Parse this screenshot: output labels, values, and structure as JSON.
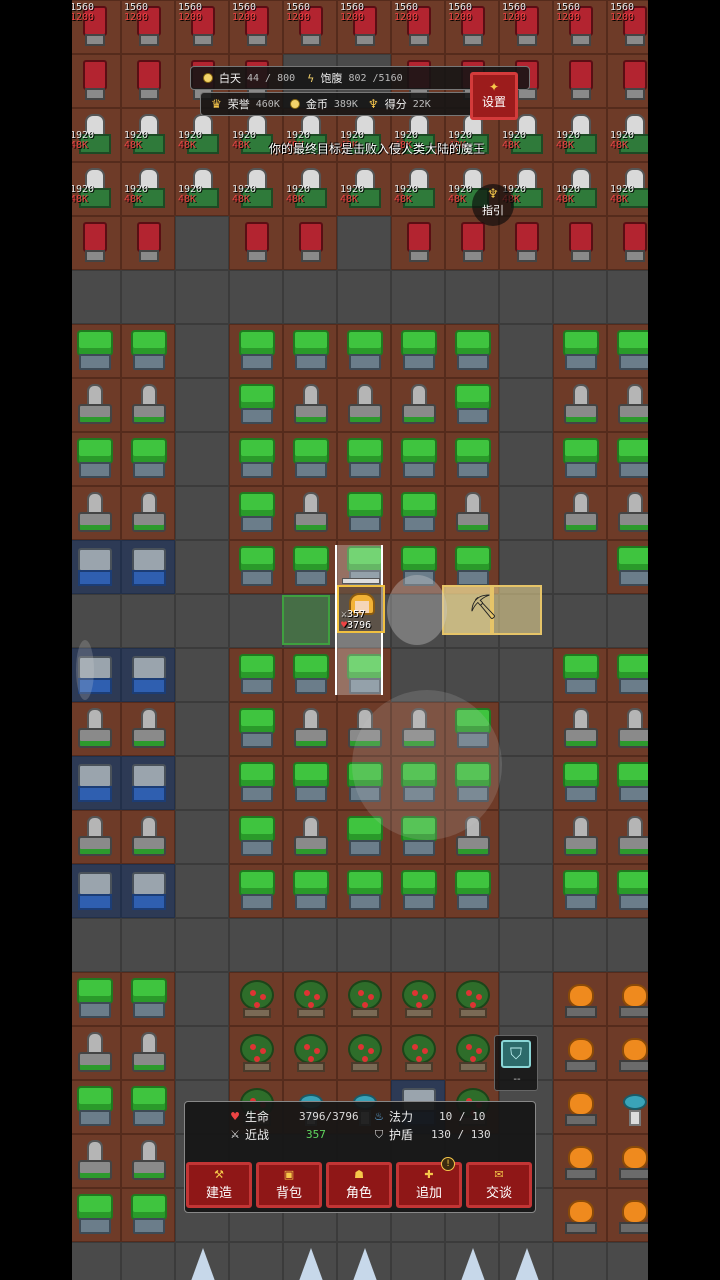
{
  "hud": {
    "day_label": "白天",
    "day_value": "44 / 800",
    "food_label": "饱腹",
    "food_value": "802 /5160",
    "honor_label": "荣誉",
    "honor_value": "460K",
    "gold_label": "金币",
    "gold_value": "389K",
    "score_label": "得分",
    "score_value": "22K",
    "goal_text": "你的最终目标是击败入侵人类大陆的魔王"
  },
  "buttons": {
    "settings": "设置",
    "guide": "指引"
  },
  "enemy_units": {
    "top_row_stats": [
      "1560",
      "1200"
    ],
    "knight_stats": [
      "1920",
      "48K"
    ]
  },
  "player": {
    "stat_line1": "357",
    "stat_line2": "3796"
  },
  "shield_widget": {
    "value": "--"
  },
  "stats_panel": {
    "hp_label": "生命",
    "hp_value": "3796/3796",
    "melee_label": "近战",
    "melee_value": "357",
    "mana_label": "法力",
    "mana_value": "10 / 10",
    "shield_label": "护盾",
    "shield_value": "130 / 130"
  },
  "actions": [
    {
      "label": "建造",
      "icon": "hammer-icon"
    },
    {
      "label": "背包",
      "icon": "bag-icon"
    },
    {
      "label": "角色",
      "icon": "character-icon"
    },
    {
      "label": "追加",
      "icon": "plus-icon",
      "badge": "!"
    },
    {
      "label": "交谈",
      "icon": "chat-icon"
    }
  ],
  "colors": {
    "button_red": "#8f1717",
    "button_border": "#c33535",
    "hp": "#e44444",
    "melee_green": "#5fd65f",
    "accent_gold": "#f6c84a"
  }
}
